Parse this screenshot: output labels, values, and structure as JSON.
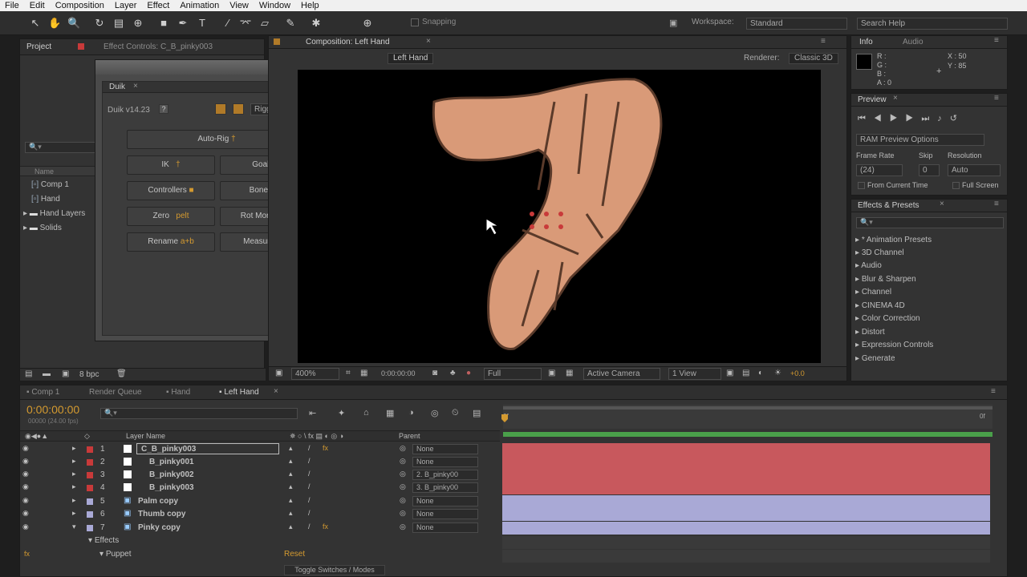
{
  "menu": [
    "File",
    "Edit",
    "Composition",
    "Layer",
    "Effect",
    "Animation",
    "View",
    "Window",
    "Help"
  ],
  "toolbar": {
    "snapping": "Snapping",
    "workspace_label": "Workspace:",
    "workspace_value": "Standard",
    "search_placeholder": "Search Help"
  },
  "project_panel": {
    "tab_project": "Project",
    "tab_effect_controls": "Effect Controls: C_B_pinky003",
    "column_name": "Name",
    "items": [
      "Comp 1",
      "Hand",
      "Hand Layers",
      "Solids"
    ],
    "bpc": "8 bpc"
  },
  "duik_panel": {
    "tab": "Duik",
    "version": "Duik v14.23",
    "help": "?",
    "mode": "Rigging",
    "buttons": [
      {
        "label": "Auto-Rig",
        "icon": "†"
      },
      {
        "label": "IK",
        "icon": "†"
      },
      {
        "label": "Goal",
        "icon": "†"
      },
      {
        "label": "Controllers",
        "icon": "■"
      },
      {
        "label": "Bones",
        "icon": "▮"
      },
      {
        "label": "Zero",
        "icon": "pelt"
      },
      {
        "label": "Rot Morph",
        "icon": "☉"
      },
      {
        "label": "Rename",
        "icon": "a+b"
      },
      {
        "label": "Measure",
        "icon": "—"
      }
    ]
  },
  "composition": {
    "tab": "Composition: Left Hand",
    "breadcrumb": "Left Hand",
    "renderer_label": "Renderer:",
    "renderer_value": "Classic 3D",
    "zoom": "400%",
    "timecode": "0:00:00:00",
    "resolution": "Full",
    "camera": "Active Camera",
    "views": "1 View",
    "exposure": "+0.0"
  },
  "info_panel": {
    "tab_info": "Info",
    "tab_audio": "Audio",
    "r": "R :",
    "g": "G :",
    "b": "B :",
    "a": "A : 0",
    "x": "X : 50",
    "y": "Y : 85"
  },
  "preview_panel": {
    "tab": "Preview",
    "ram_options": "RAM Preview Options",
    "frame_rate_label": "Frame Rate",
    "skip_label": "Skip",
    "resolution_label": "Resolution",
    "frame_rate_value": "(24)",
    "skip_value": "0",
    "resolution_value": "Auto",
    "from_current": "From Current Time",
    "full_screen": "Full Screen"
  },
  "effects_panel": {
    "tab": "Effects & Presets",
    "items": [
      "* Animation Presets",
      "3D Channel",
      "Audio",
      "Blur & Sharpen",
      "Channel",
      "CINEMA 4D",
      "Color Correction",
      "Distort",
      "Expression Controls",
      "Generate"
    ]
  },
  "timeline": {
    "tabs": [
      "Comp 1",
      "Render Queue",
      "Hand",
      "Left Hand"
    ],
    "timecode": "0:00:00:00",
    "fps": "00000 (24.00 fps)",
    "col_layer_name": "Layer Name",
    "col_parent": "Parent",
    "layers": [
      {
        "num": "1",
        "name": "C_B_pinky003",
        "parent": "None",
        "color": "#c83a3a"
      },
      {
        "num": "2",
        "name": "B_pinky001",
        "parent": "None",
        "color": "#c83a3a"
      },
      {
        "num": "3",
        "name": "B_pinky002",
        "parent": "2. B_pinky00",
        "color": "#c83a3a"
      },
      {
        "num": "4",
        "name": "B_pinky003",
        "parent": "3. B_pinky00",
        "color": "#c83a3a"
      },
      {
        "num": "5",
        "name": "Palm copy",
        "parent": "None",
        "color": "#a9a9d6"
      },
      {
        "num": "6",
        "name": "Thumb copy",
        "parent": "None",
        "color": "#a9a9d6"
      },
      {
        "num": "7",
        "name": "Pinky copy",
        "parent": "None",
        "color": "#a9a9d6"
      }
    ],
    "effects_label": "Effects",
    "puppet_label": "Puppet",
    "reset_label": "Reset",
    "toggle_switches": "Toggle Switches / Modes",
    "start_marker": "0f",
    "end_marker": "0f"
  }
}
